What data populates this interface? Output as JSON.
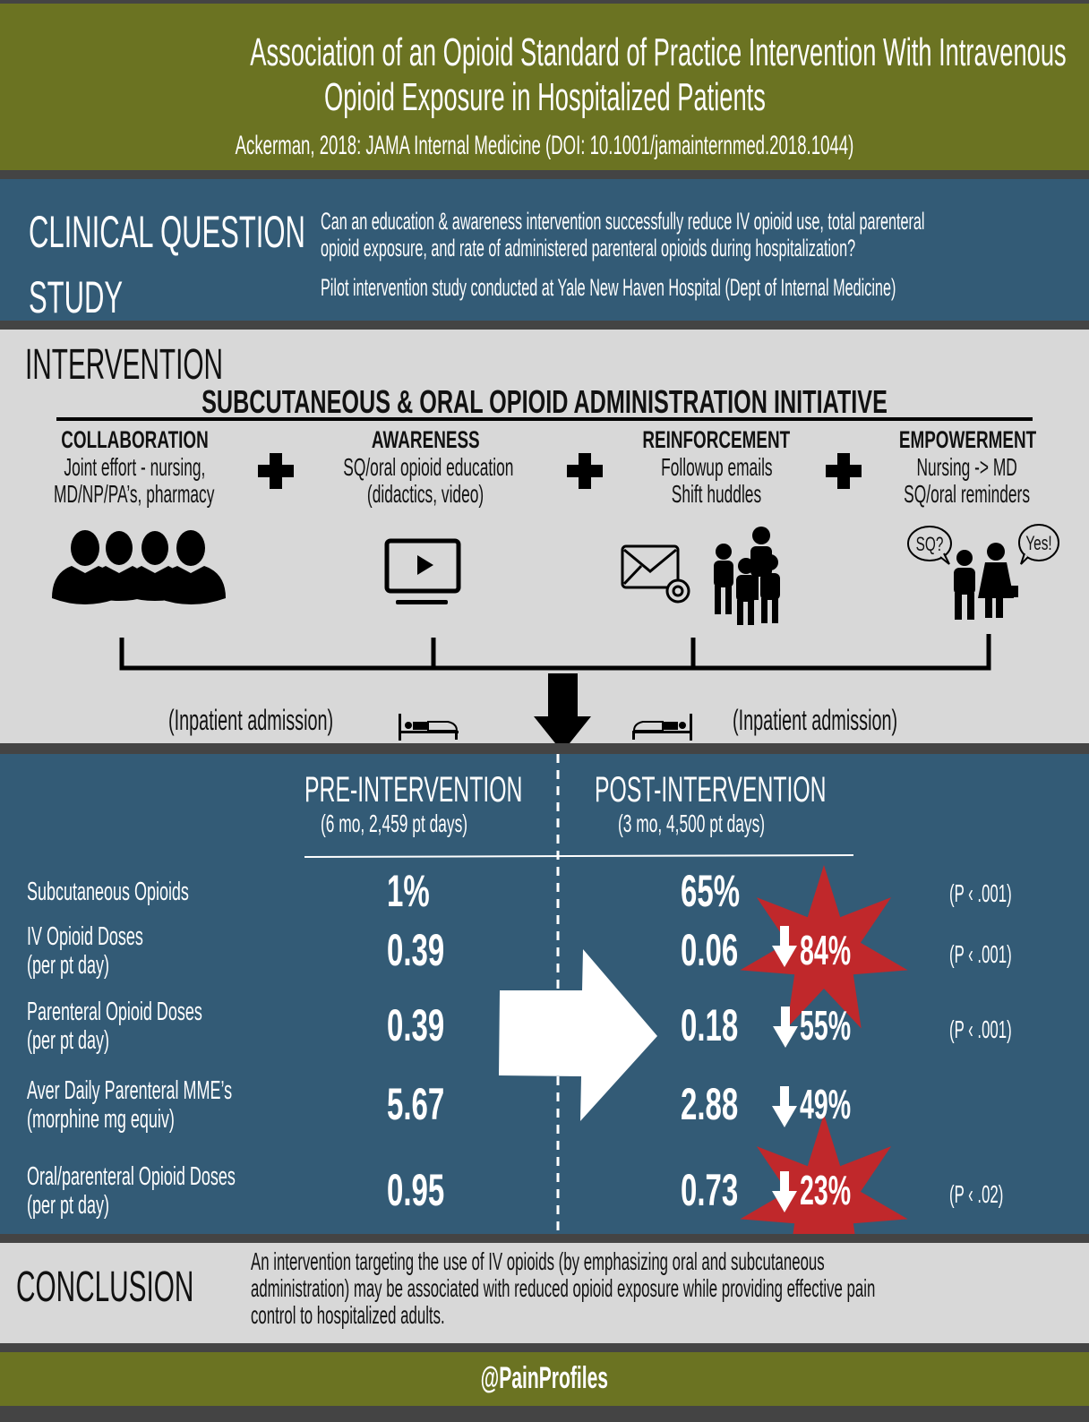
{
  "header": {
    "title_line1": "Association of an Opioid Standard of Practice Intervention With Intravenous",
    "title_line2": "Opioid Exposure in Hospitalized Patients",
    "citation": "Ackerman, 2018: JAMA Internal Medicine (DOI: 10.1001/jamainternmed.2018.1044)"
  },
  "question": {
    "label": "CLINICAL QUESTION",
    "text_line1": "Can an education & awareness intervention successfully reduce IV opioid use, total parenteral",
    "text_line2": "opioid exposure, and rate of administered parenteral opioids during hospitalization?"
  },
  "study": {
    "label": "STUDY",
    "text": "Pilot intervention study conducted at Yale New Haven Hospital (Dept of Internal Medicine)"
  },
  "intervention": {
    "label": "INTERVENTION",
    "initiative_title": "SUBCUTANEOUS & ORAL OPIOID ADMINISTRATION INITIATIVE",
    "pillars": [
      {
        "title": "COLLABORATION",
        "line1": "Joint effort - nursing,",
        "line2": "MD/NP/PA’s, pharmacy",
        "icon": "group-people-icon"
      },
      {
        "title": "AWARENESS",
        "line1": "SQ/oral opioid education",
        "line2": "(didactics, video)",
        "icon": "video-monitor-icon"
      },
      {
        "title": "REINFORCEMENT",
        "line1": "Followup emails",
        "line2": "Shift huddles",
        "icon": "email-nurses-icon"
      },
      {
        "title": "EMPOWERMENT",
        "line1": "Nursing -> MD",
        "line2": "SQ/oral reminders",
        "icon": "nurse-doctor-dialog-icon"
      }
    ],
    "bubbles": {
      "left": "SQ?",
      "right": "Yes!"
    },
    "admission_left": "(Inpatient admission)",
    "admission_right": "(Inpatient admission)"
  },
  "results": {
    "pre_header": "PRE-INTERVENTION",
    "pre_sub": "(6 mo, 2,459 pt days)",
    "post_header": "POST-INTERVENTION",
    "post_sub": "(3 mo, 4,500 pt days)",
    "rows": [
      {
        "label1": "Subcutaneous  Opioids",
        "label2": "",
        "pre": "1%",
        "post": "65%",
        "change": "",
        "p": "(P ‹ .001)"
      },
      {
        "label1": "IV Opioid Doses",
        "label2": "(per pt day)",
        "pre": "0.39",
        "post": "0.06",
        "change": "84%",
        "p": "(P ‹ .001)",
        "star": true
      },
      {
        "label1": "Parenteral Opioid Doses",
        "label2": "(per pt day)",
        "pre": "0.39",
        "post": "0.18",
        "change": "55%",
        "p": "(P ‹ .001)"
      },
      {
        "label1": "Aver Daily Parenteral MME’s",
        "label2": "(morphine mg equiv)",
        "pre": "5.67",
        "post": "2.88",
        "change": "49%",
        "p": ""
      },
      {
        "label1": "Oral/parenteral Opioid Doses",
        "label2": "(per pt day)",
        "pre": "0.95",
        "post": "0.73",
        "change": "23%",
        "p": "(P ‹ .02)",
        "star": true
      }
    ]
  },
  "conclusion": {
    "label": "CONCLUSION",
    "line1": "An intervention targeting the use of IV opioids (by emphasizing oral and subcutaneous",
    "line2": "administration) may be associated with reduced opioid exposure while providing effective pain",
    "line3": "control to hospitalized adults."
  },
  "footer": {
    "handle": "@PainProfiles"
  },
  "colors": {
    "olive": "#6b7322",
    "blue": "#335b76",
    "light": "#d8d8d8",
    "separator": "#444444",
    "star_red": "#c0282b"
  }
}
